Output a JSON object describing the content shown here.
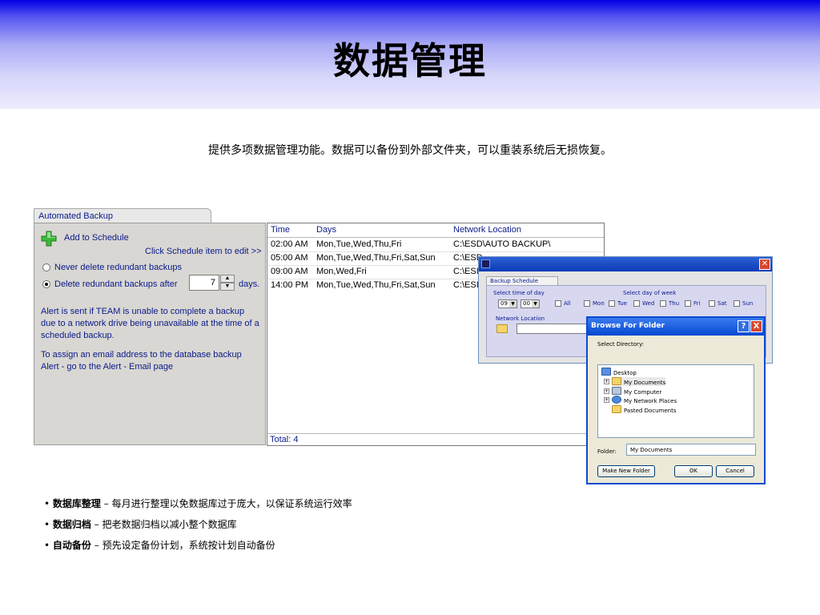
{
  "slide": {
    "title": "数据管理",
    "subtitle": "提供多项数据管理功能。数据可以备份到外部文件夹，可以重装系统后无损恢复。",
    "bullets": [
      {
        "term": "数据库整理",
        "sep": " – ",
        "desc": "每月进行整理以免数据库过于庞大，以保证系统运行效率"
      },
      {
        "term": "数据归档",
        "sep": " – ",
        "desc": "把老数据归档以减小整个数据库"
      },
      {
        "term": "自动备份",
        "sep": " – ",
        "desc": "预先设定备份计划，系统按计划自动备份"
      }
    ]
  },
  "backup_panel": {
    "tab_label": "Automated Backup",
    "add_label": "Add to Schedule",
    "edit_hint": "Click Schedule item to edit >>",
    "never_delete_label": "Never delete redundant backups",
    "delete_after_label": "Delete redundant backups after",
    "days_value": "7",
    "days_label": "days.",
    "alert_text": "Alert is sent if TEAM is unable to complete a backup due to a network drive being unavailable at the time of a scheduled backup.",
    "assign_text": "To assign an email address to the database backup Alert - go to the Alert - Email page"
  },
  "schedule_table": {
    "headers": {
      "time": "Time",
      "days": "Days",
      "location": "Network Location"
    },
    "rows": [
      {
        "time": "02:00 AM",
        "days": "Mon,Tue,Wed,Thu,Fri",
        "location": "C:\\ESD\\AUTO BACKUP\\"
      },
      {
        "time": "05:00 AM",
        "days": "Mon,Tue,Wed,Thu,Fri,Sat,Sun",
        "location": "C:\\ESD"
      },
      {
        "time": "09:00 AM",
        "days": "Mon,Wed,Fri",
        "location": "C:\\ESI"
      },
      {
        "time": "14:00 PM",
        "days": "Mon,Tue,Wed,Thu,Fri,Sat,Sun",
        "location": "C:\\ESI"
      }
    ],
    "total": "Total: 4"
  },
  "schedule_dialog": {
    "tab_label": "Backup Schedule",
    "time_label": "Select time of day",
    "hour": "09",
    "minute": "00",
    "day_label": "Select day of week",
    "days": [
      "All",
      "Mon",
      "Tue",
      "Wed",
      "Thu",
      "Fri",
      "Sat",
      "Sun"
    ],
    "location_label": "Network Location"
  },
  "browse_dialog": {
    "title": "Browse For Folder",
    "help_glyph": "?",
    "close_glyph": "X",
    "prompt": "Select Directory:",
    "tree": [
      "Desktop",
      "My Documents",
      "My Computer",
      "My Network Places",
      "Pasted Documents"
    ],
    "folder_label": "Folder:",
    "folder_value": "My Documents",
    "make_new_label": "Make New Folder",
    "ok_label": "OK",
    "cancel_label": "Cancel"
  },
  "colors": {
    "header_top": "#0000e6",
    "ui_text": "#0a1a8a",
    "panel_bg": "#d9d7d3",
    "xp_title": "#0648d0",
    "close_red": "#d9462b",
    "add_green": "#3db83d",
    "folder_yellow": "#f2d468"
  },
  "icons": {
    "add": "plus-icon",
    "spin": "spin-arrows-icon",
    "folder": "folder-icon",
    "computer": "computer-icon",
    "network": "network-places-icon"
  }
}
